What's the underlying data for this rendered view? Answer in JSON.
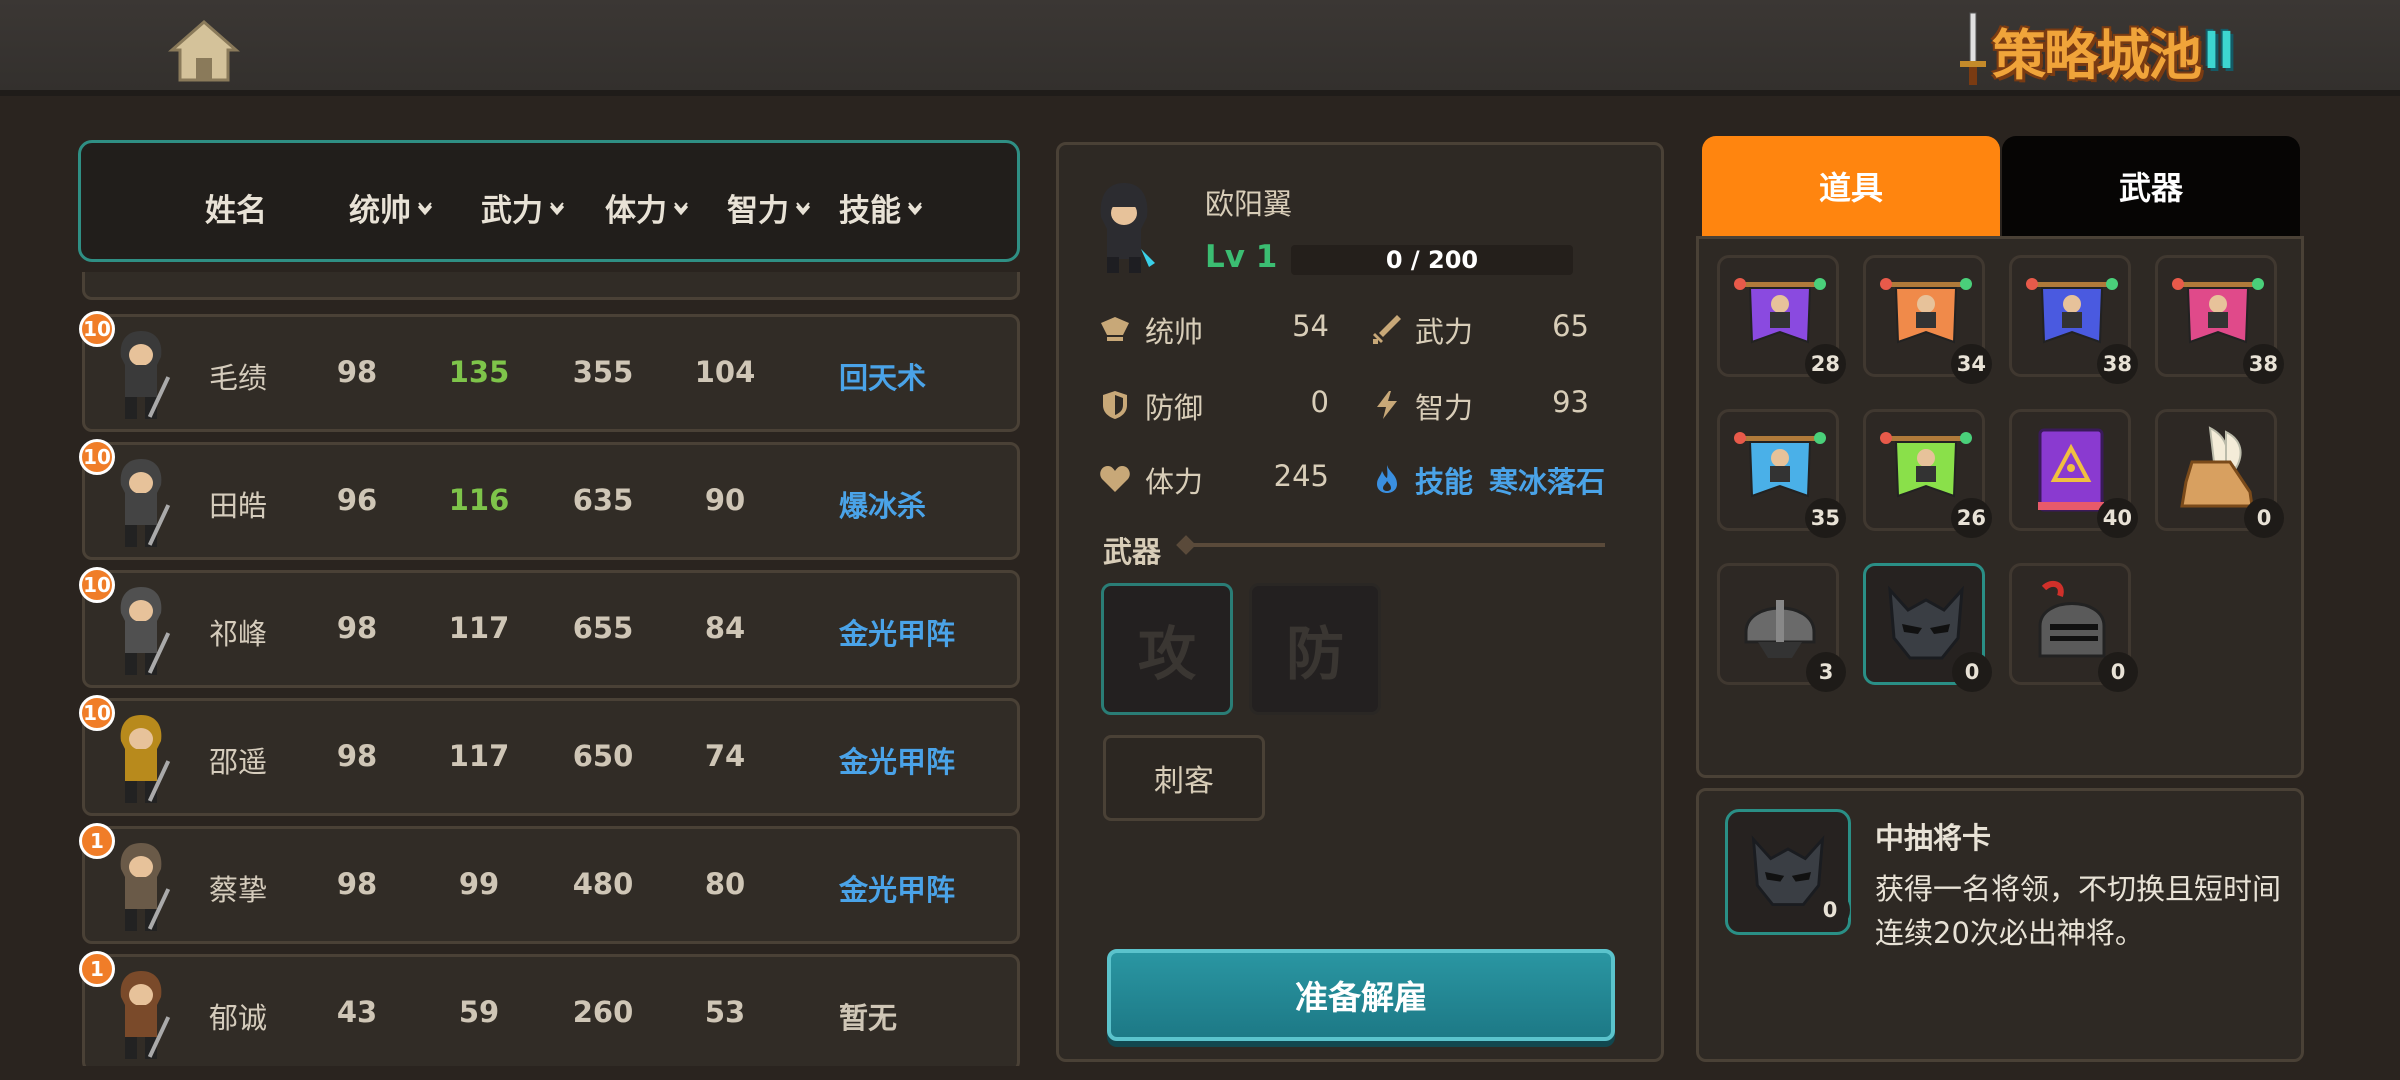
{
  "logo": {
    "text_main": "策略城池",
    "text_num": "II"
  },
  "list": {
    "headers": {
      "name": "姓名",
      "lead": "统帅",
      "force": "武力",
      "stamina": "体力",
      "intel": "智力",
      "skill": "技能"
    },
    "rows": [
      {
        "badge": "10",
        "name": "毛绩",
        "lead": "98",
        "force": "135",
        "stamina": "355",
        "intel": "104",
        "skill": "回天术",
        "force_highlight": true,
        "skill_color": "#4aa3e8",
        "avatar_color": "#3a3a3a"
      },
      {
        "badge": "10",
        "name": "田皓",
        "lead": "96",
        "force": "116",
        "stamina": "635",
        "intel": "90",
        "skill": "爆冰杀",
        "force_highlight": true,
        "skill_color": "#4aa3e8",
        "avatar_color": "#444"
      },
      {
        "badge": "10",
        "name": "祁峰",
        "lead": "98",
        "force": "117",
        "stamina": "655",
        "intel": "84",
        "skill": "金光甲阵",
        "force_highlight": false,
        "skill_color": "#4aa3e8",
        "avatar_color": "#505050"
      },
      {
        "badge": "10",
        "name": "邵遥",
        "lead": "98",
        "force": "117",
        "stamina": "650",
        "intel": "74",
        "skill": "金光甲阵",
        "force_highlight": false,
        "skill_color": "#4aa3e8",
        "avatar_color": "#b88a1c"
      },
      {
        "badge": "1",
        "name": "蔡挚",
        "lead": "98",
        "force": "99",
        "stamina": "480",
        "intel": "80",
        "skill": "金光甲阵",
        "force_highlight": false,
        "skill_color": "#4aa3e8",
        "avatar_color": "#6a5a48"
      },
      {
        "badge": "1",
        "name": "郁诚",
        "lead": "43",
        "force": "59",
        "stamina": "260",
        "intel": "53",
        "skill": "暂无",
        "force_highlight": false,
        "skill_color": "#cfc6b6",
        "avatar_color": "#7a4a2a"
      }
    ]
  },
  "detail": {
    "name": "欧阳翼",
    "level": "Lv 1",
    "xp_text": "0 / 200",
    "xp_fraction": 0,
    "stats": {
      "lead_label": "统帅",
      "lead_value": "54",
      "force_label": "武力",
      "force_value": "65",
      "defense_label": "防御",
      "defense_value": "0",
      "intel_label": "智力",
      "intel_value": "93",
      "stamina_label": "体力",
      "stamina_value": "245",
      "skill_label": "技能",
      "skill_value": "寒冰落石"
    },
    "weapon_label": "武器",
    "slot_attack": "攻",
    "slot_defense": "防",
    "class_label": "刺客",
    "dismiss_label": "准备解雇"
  },
  "inventory": {
    "tab_items": "道具",
    "tab_weapons": "武器",
    "items": [
      {
        "kind": "banner",
        "color": "#8a4ae0",
        "qty": "28"
      },
      {
        "kind": "banner",
        "color": "#f08a4a",
        "qty": "34"
      },
      {
        "kind": "banner",
        "color": "#4a5ae0",
        "qty": "38"
      },
      {
        "kind": "banner",
        "color": "#e04a8a",
        "qty": "38"
      },
      {
        "kind": "banner",
        "color": "#4ab0e8",
        "qty": "35"
      },
      {
        "kind": "banner",
        "color": "#8ae04a",
        "qty": "26"
      },
      {
        "kind": "book",
        "color": "#8a3ad0",
        "qty": "40"
      },
      {
        "kind": "boot",
        "color": "#d8a060",
        "qty": "0"
      },
      {
        "kind": "helmet",
        "color": "#6a6a6a",
        "qty": "3"
      },
      {
        "kind": "mask",
        "color": "#3a3e44",
        "qty": "0",
        "selected": true
      },
      {
        "kind": "knight",
        "color": "#5a5a5a",
        "qty": "0"
      }
    ],
    "desc_title": "中抽将卡",
    "desc_text": "获得一名将领，不切换且短时间连续20次必出神将。",
    "desc_qty": "0"
  }
}
